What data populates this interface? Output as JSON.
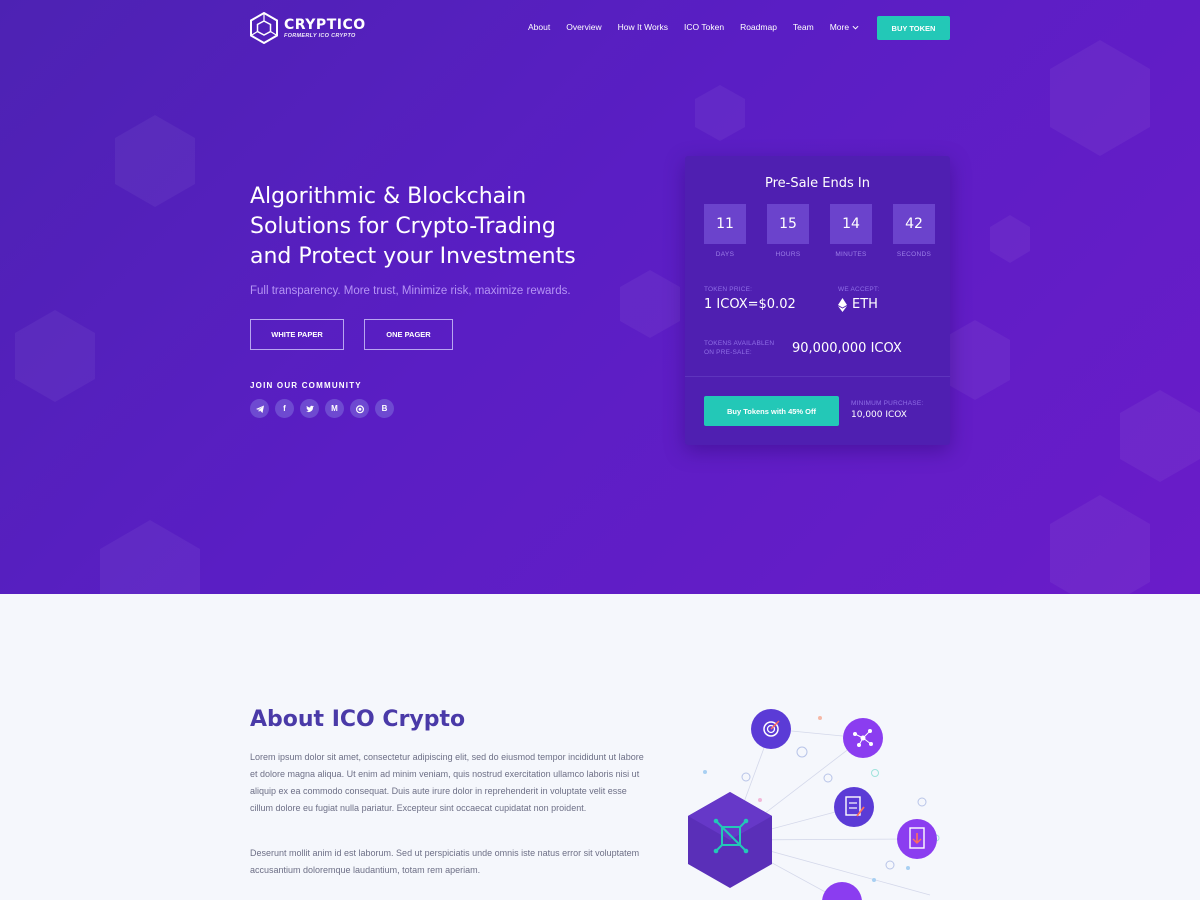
{
  "colors": {
    "hero_bg": "#5a1ec4",
    "accent": "#23c8b7",
    "card_bg": "#4f1fb1",
    "about_bg": "#f5f7fc",
    "about_title": "#4a3aa8"
  },
  "header": {
    "logo_title": "CRYPTICO",
    "logo_subtitle": "FORMERLY ICO CRYPTO",
    "nav": [
      "About",
      "Overview",
      "How It Works",
      "ICO Token",
      "Roadmap",
      "Team",
      "More"
    ],
    "buy_button": "BUY TOKEN"
  },
  "hero": {
    "headline_lines": [
      "Algorithmic & Blockchain",
      "Solutions for Crypto-Trading",
      "and Protect your Investments"
    ],
    "subline": "Full transparency. More trust, Minimize risk, maximize rewards.",
    "white_paper_button": "WHITE PAPER",
    "one_pager_button": "ONE PAGER",
    "community_label": "JOIN OUR COMMUNITY",
    "socials": [
      "telegram-icon",
      "facebook-icon",
      "twitter-icon",
      "medium-icon",
      "github-icon",
      "bitcoin-icon"
    ]
  },
  "presale": {
    "title": "Pre-Sale Ends In",
    "countdown": [
      {
        "value": "11",
        "label": "DAYS"
      },
      {
        "value": "15",
        "label": "HOURS"
      },
      {
        "value": "14",
        "label": "MINUTES"
      },
      {
        "value": "42",
        "label": "SECONDS"
      }
    ],
    "token_price_label": "TOKEN PRICE:",
    "token_price_value": "1 ICOX=$0.02",
    "accept_label": "WE ACCEPT:",
    "accept_value": "ETH",
    "available_label_1": "TOKENS AVAILABLEN",
    "available_label_2": "ON PRE-SALE:",
    "available_value": "90,000,000 ICOX",
    "cta_button": "Buy Tokens with 45% Off",
    "min_purchase_label": "MINIMUM PURCHASE:",
    "min_purchase_value": "10,000 ICOX"
  },
  "about": {
    "title": "About ICO Crypto",
    "paragraph_1": "Lorem ipsum dolor sit amet, consectetur adipiscing elit, sed do eiusmod tempor incididunt ut labore et dolore magna aliqua. Ut enim ad minim veniam, quis nostrud exercitation ullamco laboris nisi ut aliquip ex ea commodo consequat. Duis aute irure dolor in reprehenderit in voluptate velit esse cillum dolore eu fugiat nulla pariatur. Excepteur sint occaecat cupidatat non proident.",
    "paragraph_2": "Deserunt mollit anim id est laborum. Sed ut perspiciatis unde omnis iste natus error sit voluptatem accusantium doloremque laudantium, totam rem aperiam."
  }
}
